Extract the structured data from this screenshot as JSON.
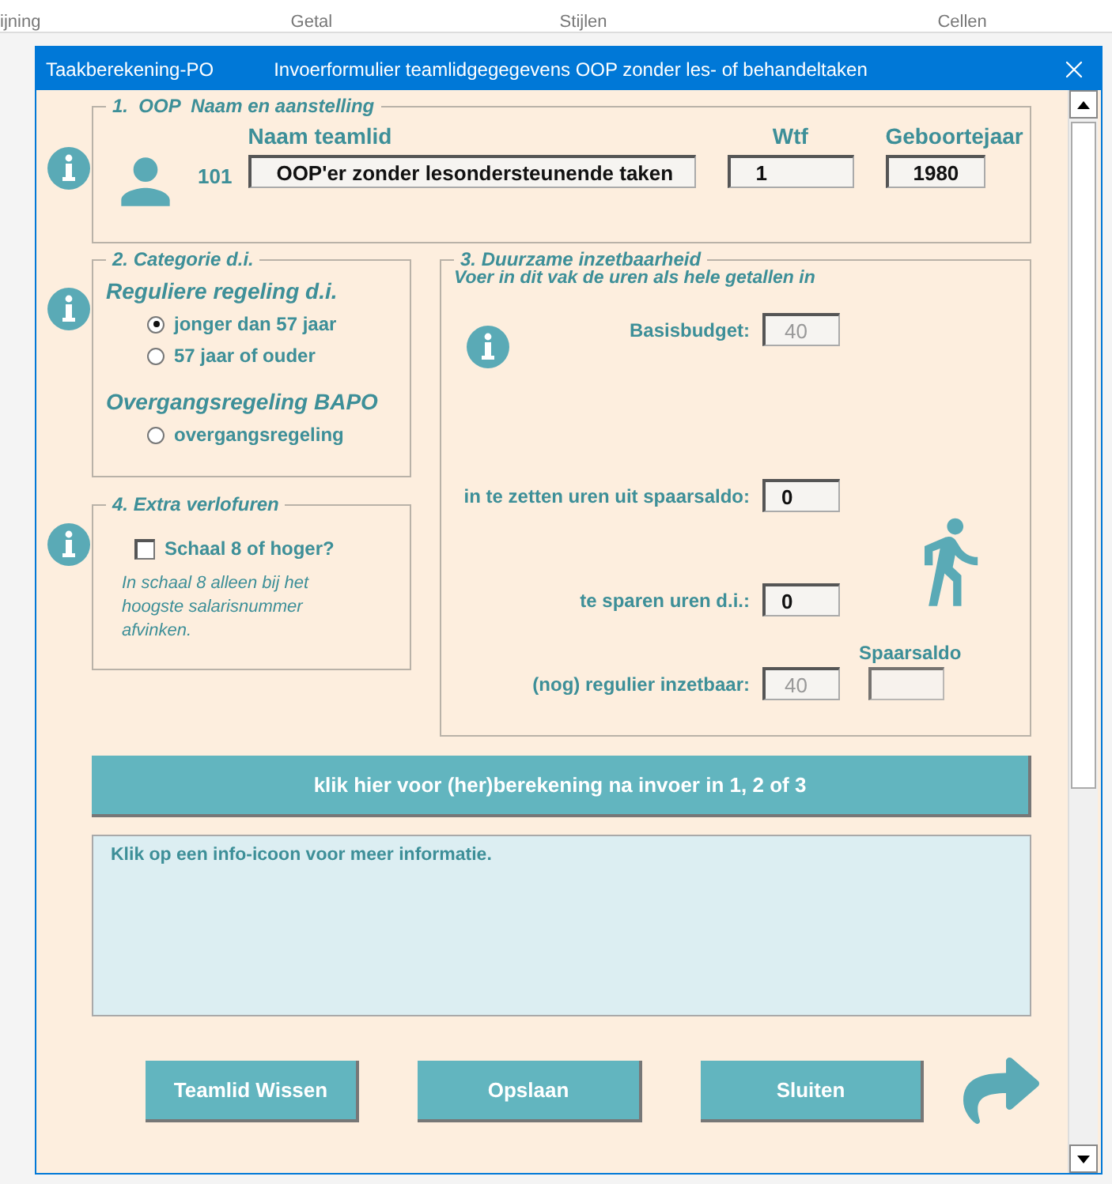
{
  "ribbon": [
    "ijning",
    "Getal",
    "Stijlen",
    "Cellen"
  ],
  "window": {
    "app": "Taakberekening-PO",
    "title": "Invoerformulier teamlidgegegevens OOP zonder les- of behandeltaken"
  },
  "section1": {
    "legend": "1.  OOP  Naam en aanstelling",
    "number": "101",
    "fields": [
      {
        "label": "Naam teamlid",
        "value": "OOP'er zonder lesondersteunende taken",
        "kind": "name"
      },
      {
        "label": "Wtf",
        "value": "1",
        "kind": "small"
      },
      {
        "label": "Geboortejaar",
        "value": "1980",
        "kind": "year"
      }
    ]
  },
  "section2": {
    "legend": "2. Categorie d.i.",
    "groups": [
      {
        "heading": "Reguliere regeling d.i.",
        "options": [
          {
            "label": "jonger dan 57 jaar",
            "selected": true
          },
          {
            "label": "57 jaar of ouder",
            "selected": false
          }
        ]
      },
      {
        "heading": "Overgangsregeling BAPO",
        "options": [
          {
            "label": "overgangsregeling",
            "selected": false
          }
        ]
      }
    ]
  },
  "section4": {
    "legend": "4. Extra verlofuren",
    "checkbox": {
      "label": "Schaal 8 of hoger?",
      "checked": false
    },
    "note": "In schaal 8 alleen bij het hoogste salarisnummer afvinken."
  },
  "section3": {
    "legend": "3. Duurzame inzetbaarheid",
    "instruction": "Voer in dit vak de uren als hele getallen in",
    "rows": [
      {
        "label": "Basisbudget:",
        "value": "40",
        "disabled": true
      },
      {
        "label": "in te zetten uren uit spaarsaldo:",
        "value": "0",
        "disabled": false
      },
      {
        "label": "te sparen uren d.i.:",
        "value": "0",
        "disabled": false
      },
      {
        "label": "(nog) regulier inzetbaar:",
        "value": "40",
        "disabled": true
      }
    ],
    "spaarsaldo": {
      "label": "Spaarsaldo",
      "disabled": true
    }
  },
  "calc_button": "klik hier voor (her)berekening na invoer in 1, 2 of 3",
  "info_text": "Klik op een info-icoon voor meer informatie.",
  "buttons": [
    "Teamlid Wissen",
    "Opslaan",
    "Sluiten"
  ]
}
